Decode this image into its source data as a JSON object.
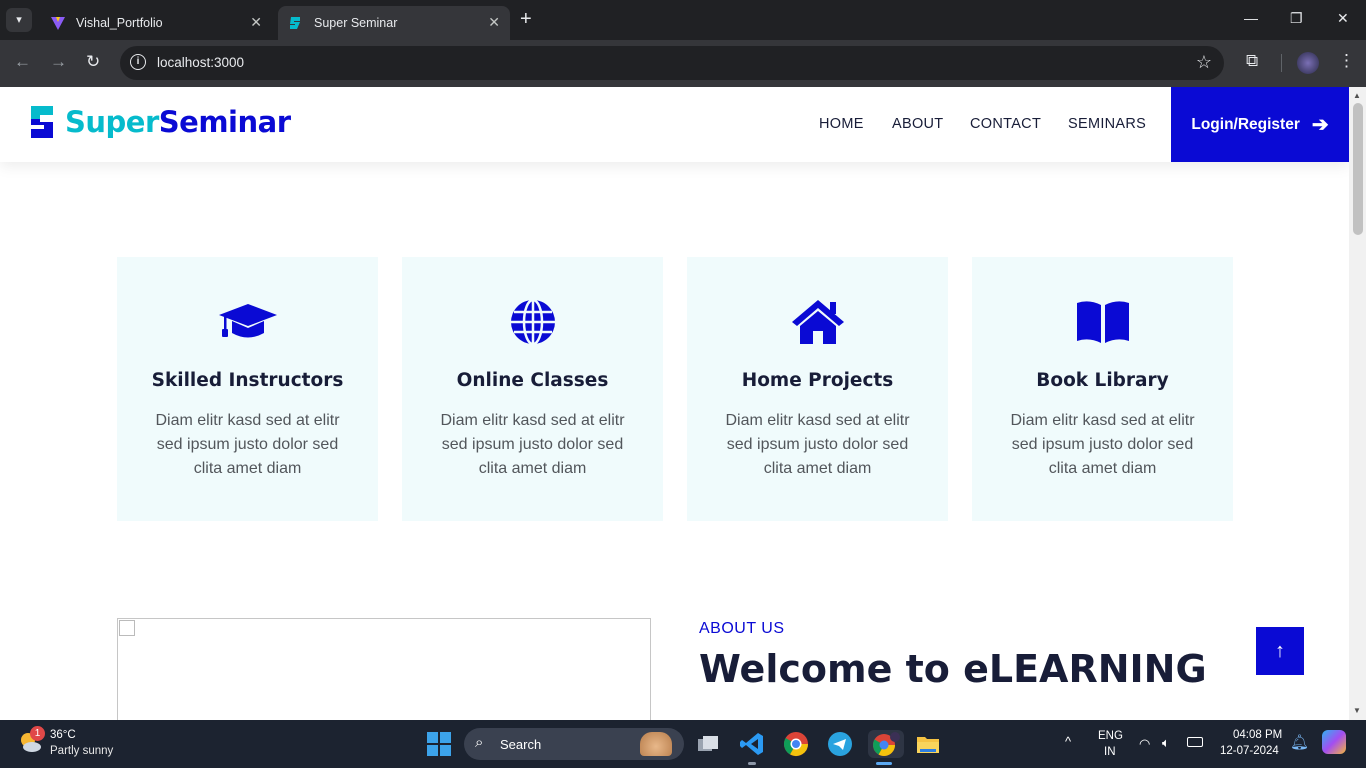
{
  "browser": {
    "tabs": [
      {
        "title": "Vishal_Portfolio",
        "active": false
      },
      {
        "title": "Super Seminar",
        "active": true
      }
    ],
    "url": "localhost:3000"
  },
  "site": {
    "brand": {
      "part1": "Super",
      "part2": "Seminar"
    },
    "nav": [
      "HOME",
      "ABOUT",
      "CONTACT",
      "SEMINARS"
    ],
    "login_label": "Login/Register",
    "features": [
      {
        "icon": "graduation-cap-icon",
        "title": "Skilled Instructors",
        "text": "Diam elitr kasd sed at elitr sed ipsum justo dolor sed clita amet diam"
      },
      {
        "icon": "globe-icon",
        "title": "Online Classes",
        "text": "Diam elitr kasd sed at elitr sed ipsum justo dolor sed clita amet diam"
      },
      {
        "icon": "home-icon",
        "title": "Home Projects",
        "text": "Diam elitr kasd sed at elitr sed ipsum justo dolor sed clita amet diam"
      },
      {
        "icon": "book-open-icon",
        "title": "Book Library",
        "text": "Diam elitr kasd sed at elitr sed ipsum justo dolor sed clita amet diam"
      }
    ],
    "about": {
      "label": "ABOUT US",
      "title": "Welcome to eLEARNING"
    },
    "colors": {
      "primary": "#0a0ad4",
      "accent": "#06bbcc",
      "card_bg": "#f0fbfc",
      "heading": "#181d38"
    }
  },
  "taskbar": {
    "weather": {
      "badge": "1",
      "temp": "36°C",
      "desc": "Partly sunny"
    },
    "search_label": "Search",
    "lang": {
      "line1": "ENG",
      "line2": "IN"
    },
    "time": "04:08 PM",
    "date": "12-07-2024"
  }
}
